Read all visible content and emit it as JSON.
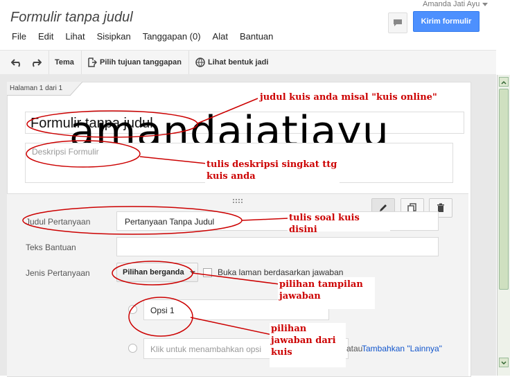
{
  "header": {
    "title": "Formulir tanpa judul",
    "user": "Amanda Jati Ayu",
    "send_label": "Kirim formulir"
  },
  "menu": [
    "File",
    "Edit",
    "Lihat",
    "Sisipkan",
    "Tanggapan (0)",
    "Alat",
    "Bantuan"
  ],
  "toolbar": {
    "theme": "Tema",
    "choose_destination": "Pilih tujuan tanggapan",
    "view_live": "Lihat bentuk jadi"
  },
  "page_tab": "Halaman 1 dari 1",
  "form": {
    "title": "Formulir tanpa judul",
    "description_placeholder": "Deskripsi Formulir"
  },
  "watermark": "amandajatiayu",
  "question": {
    "title_label": "Judul Pertanyaan",
    "title_value": "Pertanyaan Tanpa Judul",
    "help_label": "Teks Bantuan",
    "type_label": "Jenis Pertanyaan",
    "type_value": "Pilihan berganda",
    "branch_label": "Buka laman berdasarkan jawaban",
    "option1": "Opsi 1",
    "add_option_placeholder": "Klik untuk menambahkan opsi",
    "or_text": "atau",
    "add_other": "Tambahkan \"Lainnya\""
  },
  "annotations": {
    "title_note": "judul kuis anda misal \"kuis online\"",
    "desc_note_1": "tulis deskripsi singkat ttg",
    "desc_note_2": "kuis anda",
    "question_note": "tulis soal kuis disini",
    "type_note_1": "pilihan tampilan",
    "type_note_2": "jawaban",
    "option_note_1": "pilihan",
    "option_note_2": "jawaban dari",
    "option_note_3": "kuis"
  },
  "colors": {
    "accent": "#4d90fe",
    "annotation": "#cc0000"
  }
}
